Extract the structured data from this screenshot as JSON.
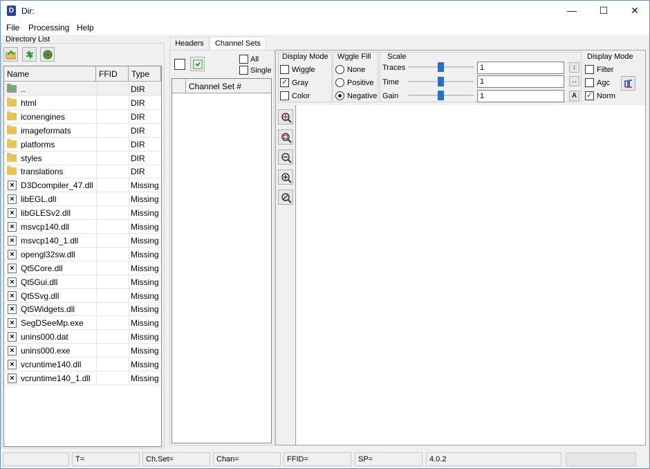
{
  "window": {
    "title": "Dir:",
    "min": "—",
    "max": "☐",
    "close": "✕"
  },
  "menu": [
    "File",
    "Processing",
    "Help"
  ],
  "directory": {
    "label": "Directory List",
    "columns": [
      "Name",
      "FFID",
      "Type"
    ],
    "rows": [
      {
        "name": "..",
        "ffid": "",
        "type": "DIR",
        "icon": "folder-up-icon"
      },
      {
        "name": "html",
        "ffid": "",
        "type": "DIR",
        "icon": "folder-icon"
      },
      {
        "name": "iconengines",
        "ffid": "",
        "type": "DIR",
        "icon": "folder-icon"
      },
      {
        "name": "imageformats",
        "ffid": "",
        "type": "DIR",
        "icon": "folder-icon"
      },
      {
        "name": "platforms",
        "ffid": "",
        "type": "DIR",
        "icon": "folder-icon"
      },
      {
        "name": "styles",
        "ffid": "",
        "type": "DIR",
        "icon": "folder-icon"
      },
      {
        "name": "translations",
        "ffid": "",
        "type": "DIR",
        "icon": "folder-icon"
      },
      {
        "name": "D3Dcompiler_47.dll",
        "ffid": "",
        "type": "Missing",
        "icon": "missing-file-icon"
      },
      {
        "name": "libEGL.dll",
        "ffid": "",
        "type": "Missing",
        "icon": "missing-file-icon"
      },
      {
        "name": "libGLESv2.dll",
        "ffid": "",
        "type": "Missing",
        "icon": "missing-file-icon"
      },
      {
        "name": "msvcp140.dll",
        "ffid": "",
        "type": "Missing",
        "icon": "missing-file-icon"
      },
      {
        "name": "msvcp140_1.dll",
        "ffid": "",
        "type": "Missing",
        "icon": "missing-file-icon"
      },
      {
        "name": "opengl32sw.dll",
        "ffid": "",
        "type": "Missing",
        "icon": "missing-file-icon"
      },
      {
        "name": "Qt5Core.dll",
        "ffid": "",
        "type": "Missing",
        "icon": "missing-file-icon"
      },
      {
        "name": "Qt5Gui.dll",
        "ffid": "",
        "type": "Missing",
        "icon": "missing-file-icon"
      },
      {
        "name": "Qt5Svg.dll",
        "ffid": "",
        "type": "Missing",
        "icon": "missing-file-icon"
      },
      {
        "name": "Qt5Widgets.dll",
        "ffid": "",
        "type": "Missing",
        "icon": "missing-file-icon"
      },
      {
        "name": "SegDSeeMp.exe",
        "ffid": "",
        "type": "Missing",
        "icon": "missing-file-icon"
      },
      {
        "name": "unins000.dat",
        "ffid": "",
        "type": "Missing",
        "icon": "missing-file-icon"
      },
      {
        "name": "unins000.exe",
        "ffid": "",
        "type": "Missing",
        "icon": "missing-file-icon"
      },
      {
        "name": "vcruntime140.dll",
        "ffid": "",
        "type": "Missing",
        "icon": "missing-file-icon"
      },
      {
        "name": "vcruntime140_1.dll",
        "ffid": "",
        "type": "Missing",
        "icon": "missing-file-icon"
      }
    ]
  },
  "tabs": [
    {
      "label": "Headers",
      "active": false
    },
    {
      "label": "Channel Sets",
      "active": true
    }
  ],
  "channel": {
    "all_label": "All",
    "single_label": "Single",
    "column": "Channel Set #"
  },
  "display_mode": {
    "title": "Display Mode",
    "wiggle": "Wiggle",
    "gray": "Gray",
    "color": "Color"
  },
  "wiggle_fill": {
    "title": "Wggle Fill",
    "none": "None",
    "positive": "Positive",
    "negative": "Negative"
  },
  "scale": {
    "title": "Scale",
    "traces": {
      "label": "Traces",
      "value": "1",
      "level": 0.5
    },
    "time": {
      "label": "Time",
      "value": "1",
      "level": 0.5
    },
    "gain": {
      "label": "Gain",
      "value": "1",
      "level": 0.5
    }
  },
  "display_mode2": {
    "title": "Display Mode",
    "filter": "Filter",
    "agc": "Agc",
    "norm": "Norm"
  },
  "status": {
    "t": "T=",
    "chset": "Ch.Set=",
    "chan": "Chan=",
    "ffid": "FFID=",
    "sp": "SP=",
    "version": "4.0.2"
  }
}
